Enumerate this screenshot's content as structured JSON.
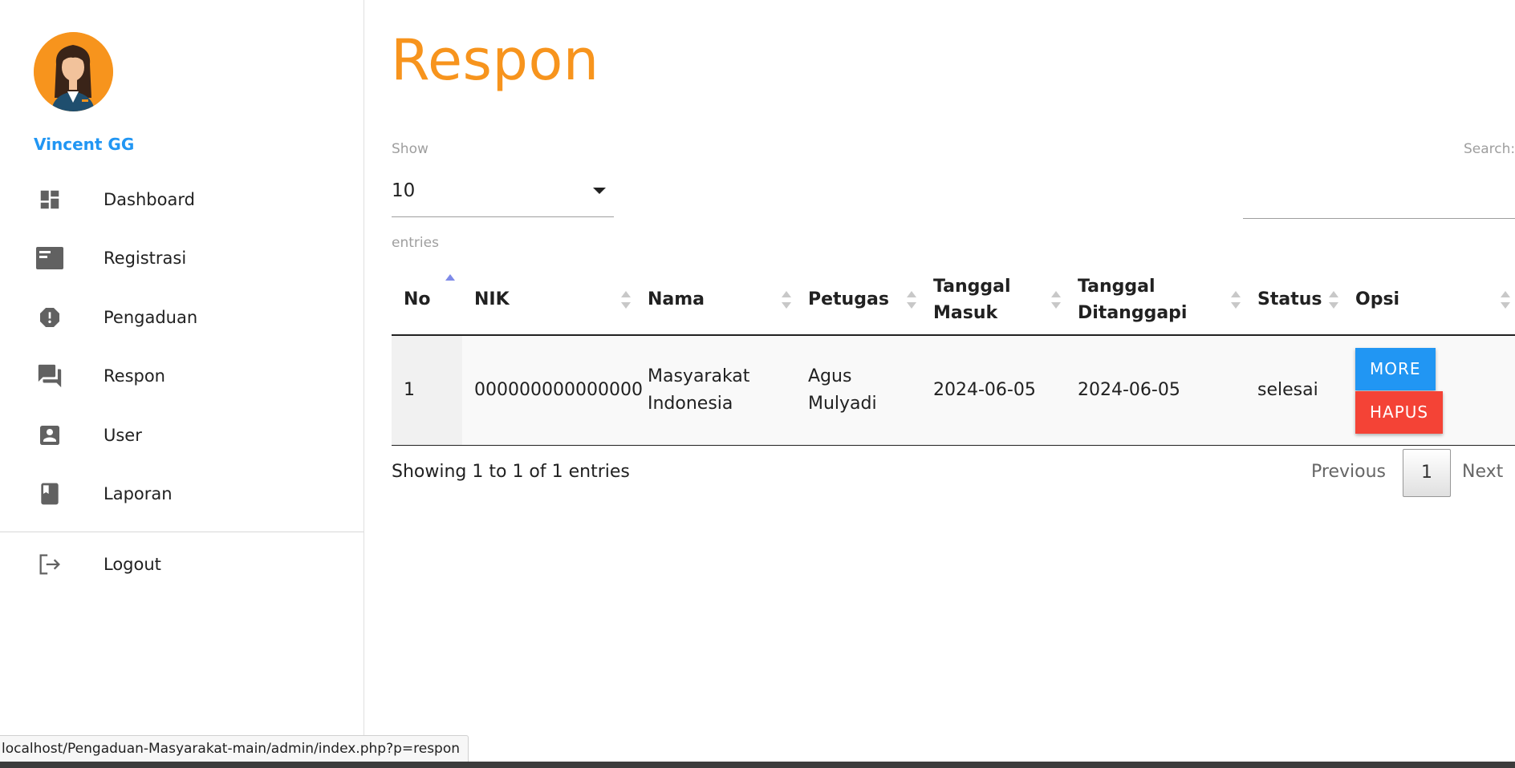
{
  "sidebar": {
    "user_name": "Vincent GG",
    "items": [
      {
        "label": "Dashboard",
        "icon": "dashboard-icon"
      },
      {
        "label": "Registrasi",
        "icon": "card-icon"
      },
      {
        "label": "Pengaduan",
        "icon": "alert-icon"
      },
      {
        "label": "Respon",
        "icon": "forum-icon"
      },
      {
        "label": "User",
        "icon": "account-box-icon"
      },
      {
        "label": "Laporan",
        "icon": "book-icon"
      }
    ],
    "logout": {
      "label": "Logout",
      "icon": "logout-icon"
    }
  },
  "main": {
    "title": "Respon",
    "length": {
      "show_label": "Show",
      "value": "10",
      "entries_label": "entries"
    },
    "search": {
      "label": "Search:",
      "value": ""
    },
    "table": {
      "headers": [
        "No",
        "NIK",
        "Nama",
        "Petugas",
        "Tanggal Masuk",
        "Tanggal Ditanggapi",
        "Status",
        "Opsi"
      ],
      "rows": [
        {
          "no": "1",
          "nik": "000000000000000",
          "nama": "Masyarakat Indonesia",
          "petugas": "Agus Mulyadi",
          "tanggal_masuk": "2024-06-05",
          "tanggal_ditanggapi": "2024-06-05",
          "status": "selesai",
          "more_label": "MORE",
          "hapus_label": "HAPUS"
        }
      ]
    },
    "info": "Showing 1 to 1 of 1 entries",
    "pagination": {
      "previous": "Previous",
      "current_page": "1",
      "next": "Next"
    }
  },
  "status_bar": {
    "url": "localhost/Pengaduan-Masyarakat-main/admin/index.php?p=respon"
  },
  "colors": {
    "accent": "#f7941d",
    "primary": "#2196f3",
    "danger": "#f44336"
  }
}
